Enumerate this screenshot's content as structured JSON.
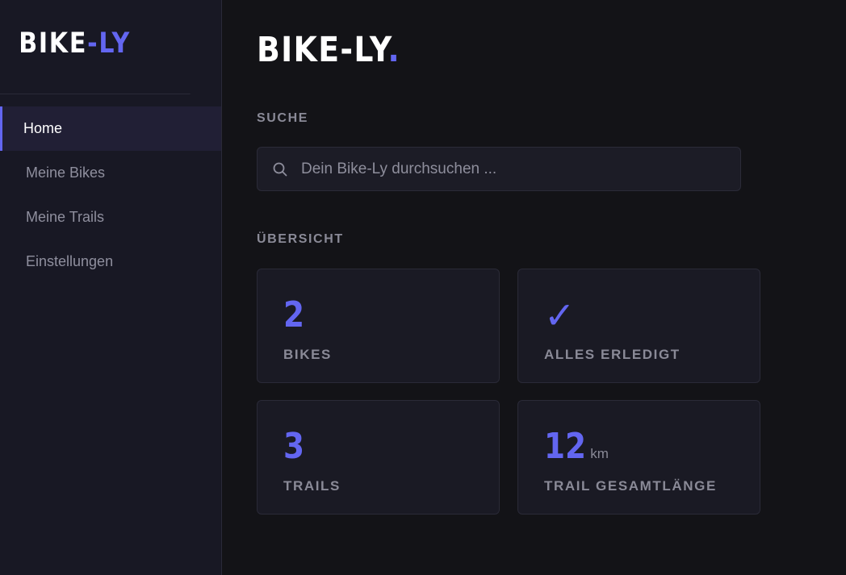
{
  "app": {
    "logo_main": "BIKE",
    "logo_sep": "-",
    "logo_accent": "LY"
  },
  "sidebar": {
    "items": [
      {
        "label": "Home",
        "active": true
      },
      {
        "label": "Meine Bikes",
        "active": false
      },
      {
        "label": "Meine Trails",
        "active": false
      },
      {
        "label": "Einstellungen",
        "active": false
      }
    ]
  },
  "main": {
    "title": "BIKE-LY",
    "title_dot": ".",
    "search_label": "SUCHE",
    "search_placeholder": "Dein Bike-Ly durchsuchen ...",
    "overview_label": "ÜBERSICHT",
    "cards": [
      {
        "value": "2",
        "label": "BIKES"
      },
      {
        "value": "✓",
        "label": "ALLES ERLEDIGT"
      },
      {
        "value": "3",
        "label": "TRAILS"
      },
      {
        "value": "12",
        "unit": "km",
        "label": "TRAIL GESAMTLÄNGE"
      }
    ]
  },
  "colors": {
    "accent": "#6366f1",
    "background": "#131317",
    "sidebar_bg": "#181824",
    "card_bg": "#1a1a24"
  },
  "icons": {
    "search": "search-icon",
    "check": "check-icon"
  }
}
